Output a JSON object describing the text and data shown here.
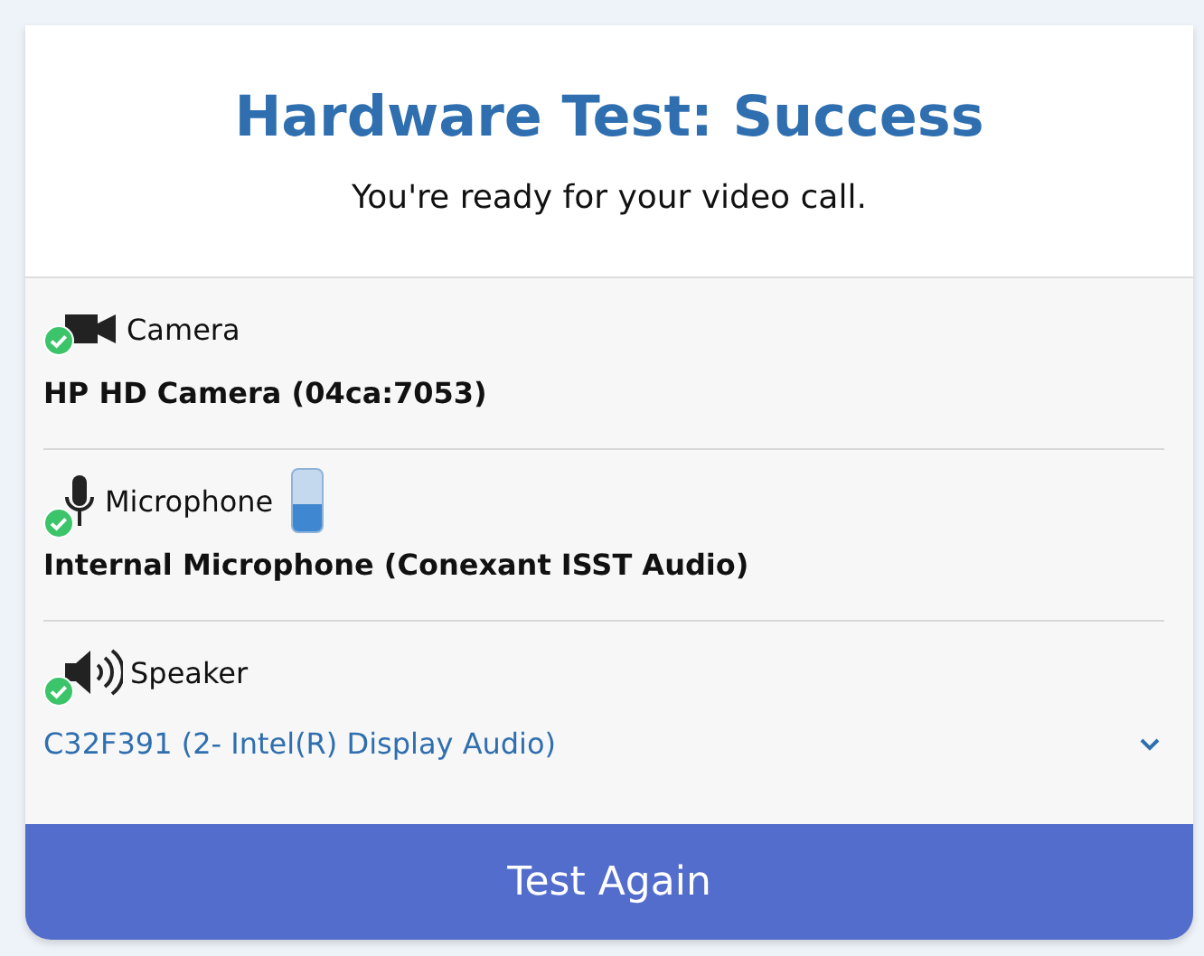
{
  "title": "Hardware Test: Success",
  "subtitle": "You're ready for your video call.",
  "devices": [
    {
      "kind": "camera",
      "label": "Camera",
      "ok": true,
      "device": "HP HD Camera (04ca:7053)"
    },
    {
      "kind": "microphone",
      "label": "Microphone",
      "ok": true,
      "level": 0.45,
      "device": "Internal Microphone (Conexant ISST Audio)"
    },
    {
      "kind": "speaker",
      "label": "Speaker",
      "ok": true,
      "select": {
        "value": "C32F391 (2- Intel(R) Display Audio)"
      }
    }
  ],
  "button": "Test Again"
}
